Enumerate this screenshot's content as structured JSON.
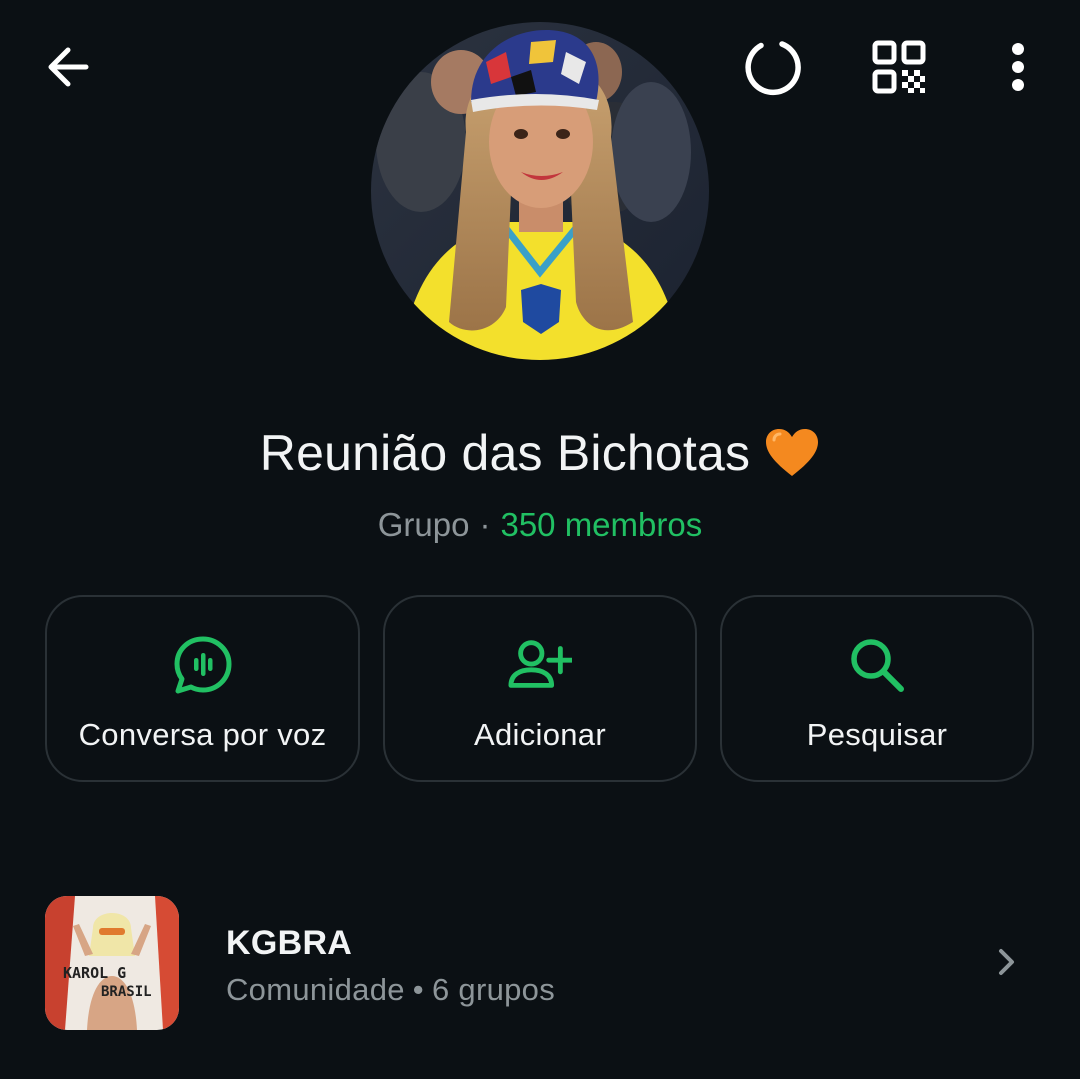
{
  "header": {
    "back_icon": "arrow-left-icon",
    "sync_icon": "sync-progress-icon",
    "qr_icon": "qr-code-icon",
    "menu_icon": "more-vert-icon"
  },
  "group": {
    "name": "Reunião das Bichotas",
    "emoji_icon": "orange-heart-icon",
    "type": "Grupo",
    "separator": "·",
    "members": "350 membros"
  },
  "actions": [
    {
      "label": "Conversa por voz",
      "icon": "voice-chat-icon"
    },
    {
      "label": "Adicionar",
      "icon": "add-person-icon"
    },
    {
      "label": "Pesquisar",
      "icon": "search-icon"
    }
  ],
  "community": {
    "name": "KGBRA",
    "type": "Comunidade",
    "separator": "•",
    "groups": "6 grupos",
    "thumb_text_1": "KAROL G",
    "thumb_text_2": "BRASIL"
  },
  "colors": {
    "background": "#0b1014",
    "accent": "#21c063",
    "muted_text": "#8d9599",
    "border": "#2a3136"
  }
}
